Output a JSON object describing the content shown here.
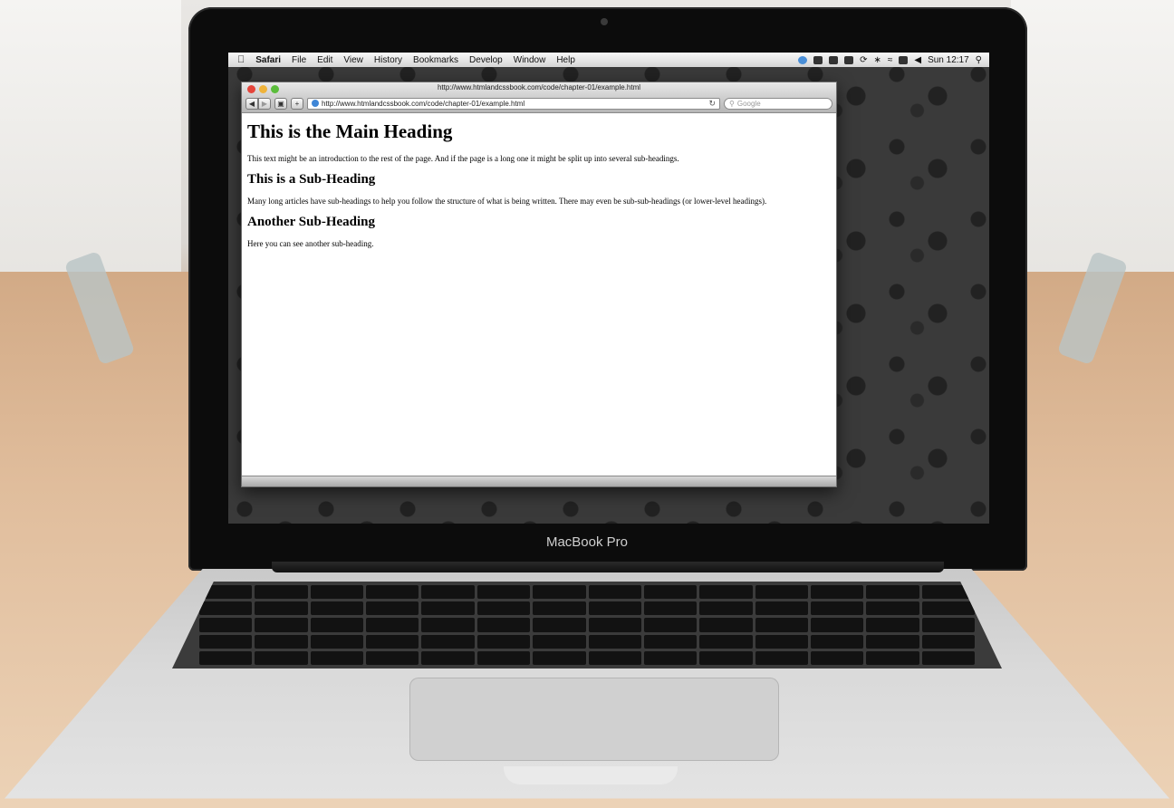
{
  "menubar": {
    "items": [
      "Safari",
      "File",
      "Edit",
      "View",
      "History",
      "Bookmarks",
      "Develop",
      "Window",
      "Help"
    ],
    "clock": "Sun 12:17"
  },
  "browser": {
    "window_title": "http://www.htmlandcssbook.com/code/chapter-01/example.html",
    "address": "http://www.htmlandcssbook.com/code/chapter-01/example.html",
    "search_placeholder": "Google"
  },
  "page": {
    "main_heading": "This is the Main Heading",
    "intro": "This text might be an introduction to the rest of the page. And if the page is a long one it might be split up into several sub-headings.",
    "sub_heading_1": "This is a Sub-Heading",
    "sub_text_1": "Many long articles have sub-headings to help you follow the structure of what is being written. There may even be sub-sub-headings (or lower-level headings).",
    "sub_heading_2": "Another Sub-Heading",
    "sub_text_2": "Here you can see another sub-heading."
  },
  "device": {
    "label": "MacBook Pro"
  }
}
